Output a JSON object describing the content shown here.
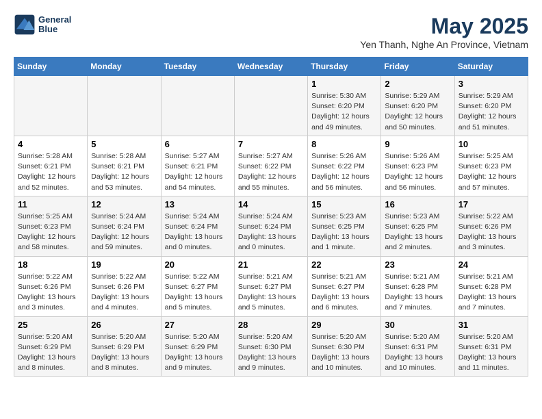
{
  "header": {
    "logo_line1": "General",
    "logo_line2": "Blue",
    "title": "May 2025",
    "subtitle": "Yen Thanh, Nghe An Province, Vietnam"
  },
  "days_of_week": [
    "Sunday",
    "Monday",
    "Tuesday",
    "Wednesday",
    "Thursday",
    "Friday",
    "Saturday"
  ],
  "weeks": [
    [
      {
        "day": "",
        "info": ""
      },
      {
        "day": "",
        "info": ""
      },
      {
        "day": "",
        "info": ""
      },
      {
        "day": "",
        "info": ""
      },
      {
        "day": "1",
        "info": "Sunrise: 5:30 AM\nSunset: 6:20 PM\nDaylight: 12 hours\nand 49 minutes."
      },
      {
        "day": "2",
        "info": "Sunrise: 5:29 AM\nSunset: 6:20 PM\nDaylight: 12 hours\nand 50 minutes."
      },
      {
        "day": "3",
        "info": "Sunrise: 5:29 AM\nSunset: 6:20 PM\nDaylight: 12 hours\nand 51 minutes."
      }
    ],
    [
      {
        "day": "4",
        "info": "Sunrise: 5:28 AM\nSunset: 6:21 PM\nDaylight: 12 hours\nand 52 minutes."
      },
      {
        "day": "5",
        "info": "Sunrise: 5:28 AM\nSunset: 6:21 PM\nDaylight: 12 hours\nand 53 minutes."
      },
      {
        "day": "6",
        "info": "Sunrise: 5:27 AM\nSunset: 6:21 PM\nDaylight: 12 hours\nand 54 minutes."
      },
      {
        "day": "7",
        "info": "Sunrise: 5:27 AM\nSunset: 6:22 PM\nDaylight: 12 hours\nand 55 minutes."
      },
      {
        "day": "8",
        "info": "Sunrise: 5:26 AM\nSunset: 6:22 PM\nDaylight: 12 hours\nand 56 minutes."
      },
      {
        "day": "9",
        "info": "Sunrise: 5:26 AM\nSunset: 6:23 PM\nDaylight: 12 hours\nand 56 minutes."
      },
      {
        "day": "10",
        "info": "Sunrise: 5:25 AM\nSunset: 6:23 PM\nDaylight: 12 hours\nand 57 minutes."
      }
    ],
    [
      {
        "day": "11",
        "info": "Sunrise: 5:25 AM\nSunset: 6:23 PM\nDaylight: 12 hours\nand 58 minutes."
      },
      {
        "day": "12",
        "info": "Sunrise: 5:24 AM\nSunset: 6:24 PM\nDaylight: 12 hours\nand 59 minutes."
      },
      {
        "day": "13",
        "info": "Sunrise: 5:24 AM\nSunset: 6:24 PM\nDaylight: 13 hours\nand 0 minutes."
      },
      {
        "day": "14",
        "info": "Sunrise: 5:24 AM\nSunset: 6:24 PM\nDaylight: 13 hours\nand 0 minutes."
      },
      {
        "day": "15",
        "info": "Sunrise: 5:23 AM\nSunset: 6:25 PM\nDaylight: 13 hours\nand 1 minute."
      },
      {
        "day": "16",
        "info": "Sunrise: 5:23 AM\nSunset: 6:25 PM\nDaylight: 13 hours\nand 2 minutes."
      },
      {
        "day": "17",
        "info": "Sunrise: 5:22 AM\nSunset: 6:26 PM\nDaylight: 13 hours\nand 3 minutes."
      }
    ],
    [
      {
        "day": "18",
        "info": "Sunrise: 5:22 AM\nSunset: 6:26 PM\nDaylight: 13 hours\nand 3 minutes."
      },
      {
        "day": "19",
        "info": "Sunrise: 5:22 AM\nSunset: 6:26 PM\nDaylight: 13 hours\nand 4 minutes."
      },
      {
        "day": "20",
        "info": "Sunrise: 5:22 AM\nSunset: 6:27 PM\nDaylight: 13 hours\nand 5 minutes."
      },
      {
        "day": "21",
        "info": "Sunrise: 5:21 AM\nSunset: 6:27 PM\nDaylight: 13 hours\nand 5 minutes."
      },
      {
        "day": "22",
        "info": "Sunrise: 5:21 AM\nSunset: 6:27 PM\nDaylight: 13 hours\nand 6 minutes."
      },
      {
        "day": "23",
        "info": "Sunrise: 5:21 AM\nSunset: 6:28 PM\nDaylight: 13 hours\nand 7 minutes."
      },
      {
        "day": "24",
        "info": "Sunrise: 5:21 AM\nSunset: 6:28 PM\nDaylight: 13 hours\nand 7 minutes."
      }
    ],
    [
      {
        "day": "25",
        "info": "Sunrise: 5:20 AM\nSunset: 6:29 PM\nDaylight: 13 hours\nand 8 minutes."
      },
      {
        "day": "26",
        "info": "Sunrise: 5:20 AM\nSunset: 6:29 PM\nDaylight: 13 hours\nand 8 minutes."
      },
      {
        "day": "27",
        "info": "Sunrise: 5:20 AM\nSunset: 6:29 PM\nDaylight: 13 hours\nand 9 minutes."
      },
      {
        "day": "28",
        "info": "Sunrise: 5:20 AM\nSunset: 6:30 PM\nDaylight: 13 hours\nand 9 minutes."
      },
      {
        "day": "29",
        "info": "Sunrise: 5:20 AM\nSunset: 6:30 PM\nDaylight: 13 hours\nand 10 minutes."
      },
      {
        "day": "30",
        "info": "Sunrise: 5:20 AM\nSunset: 6:31 PM\nDaylight: 13 hours\nand 10 minutes."
      },
      {
        "day": "31",
        "info": "Sunrise: 5:20 AM\nSunset: 6:31 PM\nDaylight: 13 hours\nand 11 minutes."
      }
    ]
  ]
}
